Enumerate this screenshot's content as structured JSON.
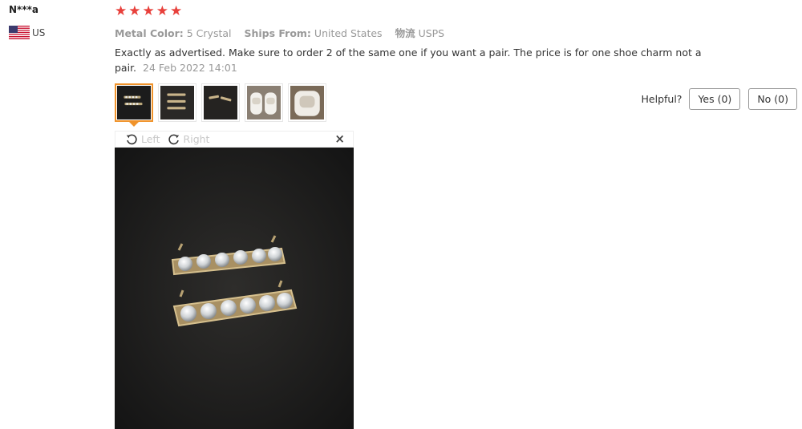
{
  "reviewer": {
    "name": "N***a",
    "country_code": "US",
    "flag_icon": "us-flag-icon"
  },
  "rating": {
    "stars": 5,
    "star_color": "#e8403b"
  },
  "attributes": [
    {
      "key": "Metal Color:",
      "value": "5 Crystal"
    },
    {
      "key": "Ships From:",
      "value": "United States"
    },
    {
      "key": "物流",
      "value": "USPS"
    }
  ],
  "review": {
    "text": "Exactly as advertised. Make sure to order 2 of the same one if you want a pair. The price is for one shoe charm not a pair.",
    "date": "24 Feb 2022 14:01"
  },
  "thumbnails": {
    "count": 5,
    "active_index": 0,
    "active_border_color": "#f0932b"
  },
  "helpful": {
    "label": "Helpful?",
    "yes_label": "Yes (0)",
    "no_label": "No (0)"
  },
  "viewer": {
    "rotate_left_label": "Left",
    "rotate_right_label": "Right",
    "close_label": "×"
  }
}
